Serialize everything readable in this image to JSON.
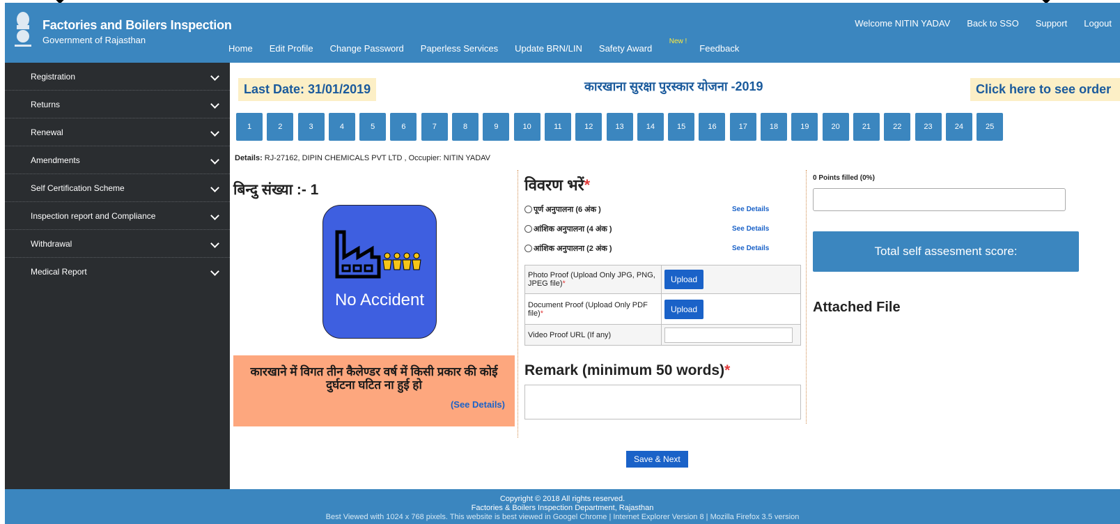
{
  "header": {
    "title": "Factories and Boilers Inspection",
    "subtitle": "Government of Rajasthan",
    "nav": [
      "Home",
      "Edit Profile",
      "Change Password",
      "Paperless Services",
      "Update BRN/LIN",
      "Safety Award",
      "Feedback"
    ],
    "new_badge": "New !",
    "right_links": [
      "Welcome NITIN YADAV",
      "Back to SSO",
      "Support",
      "Logout"
    ],
    "colors": {
      "bar": "#3b86bf",
      "badge": "#ffeb3b"
    }
  },
  "sidebar": {
    "items": [
      {
        "label": "Registration"
      },
      {
        "label": "Returns"
      },
      {
        "label": "Renewal"
      },
      {
        "label": "Amendments"
      },
      {
        "label": "Self Certification Scheme"
      },
      {
        "label": "Inspection report and Compliance"
      },
      {
        "label": "Withdrawal"
      },
      {
        "label": "Medical Report"
      }
    ]
  },
  "main": {
    "last_date": "Last Date: 31/01/2019",
    "scheme_title": "कारखाना सुरक्षा पुरस्कार योजना -2019",
    "order_link": "Click here to see order",
    "pages": [
      "1",
      "2",
      "3",
      "4",
      "5",
      "6",
      "7",
      "8",
      "9",
      "10",
      "11",
      "12",
      "13",
      "14",
      "15",
      "16",
      "17",
      "18",
      "19",
      "20",
      "21",
      "22",
      "23",
      "24",
      "25"
    ],
    "details_label": "Details:",
    "details_value": " RJ-27162, DIPIN CHEMICALS PVT LTD , Occupier: NITIN YADAV",
    "point_number": "बिन्दु संख्या :- 1",
    "tile_text": "No Accident",
    "criteria_text": "कारखाने में विगत तीन कैलेण्डर वर्ष में किसी प्रकार की कोई दुर्घटना घटित ना हुई हो",
    "criteria_link": "(See Details)",
    "fill_title": "विवरण भरें",
    "options": [
      {
        "label": "पूर्ण अनुपालना (6 अंक )",
        "link": "See Details"
      },
      {
        "label": "आंशिक अनुपालना (4 अंक )",
        "link": "See Details"
      },
      {
        "label": "आंशिक अनुपालना (2 अंक )",
        "link": "See Details"
      }
    ],
    "photo_proof": "Photo Proof (Upload Only JPG, PNG, JPEG file)",
    "document_proof": "Document Proof (Upload Only PDF file)",
    "video_proof": "Video Proof URL (If any)",
    "upload_label": "Upload",
    "remark_title": "Remark (minimum 50 words)",
    "required_mark": "*",
    "points_filled": "0 Points filled (0%)",
    "score_label": "Total self assesment score:",
    "attached_file": "Attached File",
    "save_label": "Save & Next"
  },
  "footer": {
    "line1": "Copyright © 2018 All rights reserved.",
    "line2": "Factories & Boilers Inspection Department, Rajasthan",
    "line3": "Best Viewed with 1024 x 768 pixels. This website is best viewed in Googel Chrome | Internet Explorer Version 8 | Mozilla Firefox 3.5 version"
  }
}
